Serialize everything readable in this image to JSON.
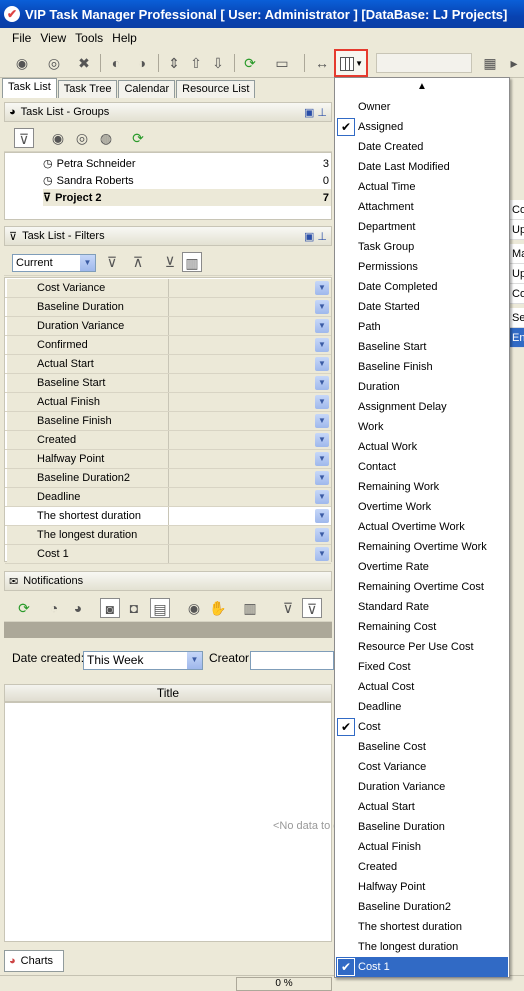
{
  "window": {
    "title": "VIP Task Manager Professional [ User: Administrator ] [DataBase: LJ Projects]"
  },
  "menu": [
    "File",
    "View",
    "Tools",
    "Help"
  ],
  "tabs": [
    "Task List",
    "Task Tree",
    "Calendar",
    "Resource List"
  ],
  "groups_panel": {
    "title": "Task List - Groups",
    "rows": [
      {
        "label": "Petra Schneider",
        "count": "3"
      },
      {
        "label": "Sandra Roberts",
        "count": "0"
      },
      {
        "label": "Project 2",
        "count": "7"
      }
    ]
  },
  "filters_panel": {
    "title": "Task List - Filters",
    "current": "Current",
    "rows": [
      "Cost Variance",
      "Baseline Duration",
      "Duration Variance",
      "Confirmed",
      "Actual Start",
      "Baseline Start",
      "Actual Finish",
      "Baseline Finish",
      "Created",
      "Halfway Point",
      "Baseline Duration2",
      "Deadline",
      "The shortest duration",
      "The longest duration",
      "Cost 1"
    ]
  },
  "notifications": {
    "title": "Notifications",
    "date_created_label": "Date created:",
    "date_created_value": "This Week",
    "creator_label": "Creator:",
    "title_column": "Title",
    "no_data": "<No data to display>"
  },
  "charts_tab": "Charts",
  "status": {
    "progress": "0 %"
  },
  "right_cells": [
    "Co",
    "Up",
    "Ma",
    "Up",
    "Co",
    "Se",
    "En"
  ],
  "column_menu": {
    "items": [
      {
        "label": "Owner",
        "checked": false
      },
      {
        "label": "Assigned",
        "checked": true
      },
      {
        "label": "Date Created",
        "checked": false
      },
      {
        "label": "Date Last Modified",
        "checked": false
      },
      {
        "label": "Actual Time",
        "checked": false
      },
      {
        "label": "Attachment",
        "checked": false
      },
      {
        "label": "Department",
        "checked": false
      },
      {
        "label": "Task Group",
        "checked": false
      },
      {
        "label": "Permissions",
        "checked": false
      },
      {
        "label": "Date Completed",
        "checked": false
      },
      {
        "label": "Date Started",
        "checked": false
      },
      {
        "label": "Path",
        "checked": false
      },
      {
        "label": "Baseline Start",
        "checked": false
      },
      {
        "label": "Baseline Finish",
        "checked": false
      },
      {
        "label": "Duration",
        "checked": false
      },
      {
        "label": "Assignment Delay",
        "checked": false
      },
      {
        "label": "Work",
        "checked": false
      },
      {
        "label": "Actual Work",
        "checked": false
      },
      {
        "label": "Contact",
        "checked": false
      },
      {
        "label": "Remaining Work",
        "checked": false
      },
      {
        "label": "Overtime Work",
        "checked": false
      },
      {
        "label": "Actual Overtime Work",
        "checked": false
      },
      {
        "label": "Remaining Overtime Work",
        "checked": false
      },
      {
        "label": "Overtime Rate",
        "checked": false
      },
      {
        "label": "Remaining Overtime Cost",
        "checked": false
      },
      {
        "label": "Standard Rate",
        "checked": false
      },
      {
        "label": "Remaining Cost",
        "checked": false
      },
      {
        "label": "Resource Per Use Cost",
        "checked": false
      },
      {
        "label": "Fixed Cost",
        "checked": false
      },
      {
        "label": "Actual Cost",
        "checked": false
      },
      {
        "label": "Deadline",
        "checked": false
      },
      {
        "label": "Cost",
        "checked": true
      },
      {
        "label": "Baseline Cost",
        "checked": false
      },
      {
        "label": "Cost Variance",
        "checked": false
      },
      {
        "label": "Duration Variance",
        "checked": false
      },
      {
        "label": "Actual Start",
        "checked": false
      },
      {
        "label": "Baseline Duration",
        "checked": false
      },
      {
        "label": "Actual Finish",
        "checked": false
      },
      {
        "label": "Created",
        "checked": false
      },
      {
        "label": "Halfway Point",
        "checked": false
      },
      {
        "label": "Baseline Duration2",
        "checked": false
      },
      {
        "label": "The shortest duration",
        "checked": false
      },
      {
        "label": "The longest duration",
        "checked": false
      },
      {
        "label": "Cost 1",
        "checked": true,
        "highlighted": true
      }
    ]
  }
}
